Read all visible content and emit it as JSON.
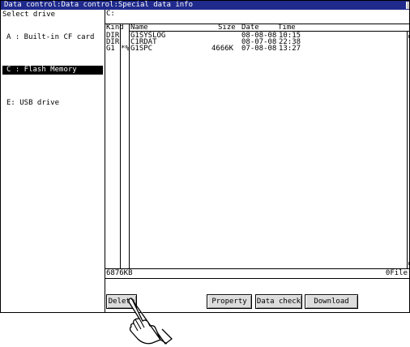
{
  "window": {
    "title": "Data control:Data control:Special data info"
  },
  "drive_panel": {
    "heading": "Select drive",
    "drives": [
      {
        "label": "A : Built-in CF card",
        "selected": false
      },
      {
        "label": "C : Flash Memory",
        "selected": true
      },
      {
        "label": "E: USB drive",
        "selected": false
      }
    ]
  },
  "file_list": {
    "path": "C:",
    "columns": {
      "kind": "Kind",
      "name": "Name",
      "size": "Size",
      "date": "Date",
      "time": "Time"
    },
    "rows": [
      {
        "kind": "DIR",
        "flag": "",
        "name": "G1SYSLOG",
        "size": "",
        "date": "08-08-08",
        "time": "10:15"
      },
      {
        "kind": "DIR",
        "flag": "",
        "name": "C1RDAT",
        "size": "",
        "date": "08-07-08",
        "time": "22:38"
      },
      {
        "kind": "G1",
        "flag": "*%",
        "name": "G1SPC",
        "size": "4666K",
        "date": "07-08-08",
        "time": "13:27"
      }
    ],
    "free_space": "6876KB",
    "file_count": "0File"
  },
  "buttons": {
    "delete": "Delete",
    "property": "Property",
    "data_check": "Data check",
    "download": "Download"
  },
  "colors": {
    "title_bar": "#1f2a8c",
    "selection": "#000000",
    "button_face": "#dcdcdc"
  },
  "icons": {
    "pointer": "pointing-hand-icon"
  }
}
